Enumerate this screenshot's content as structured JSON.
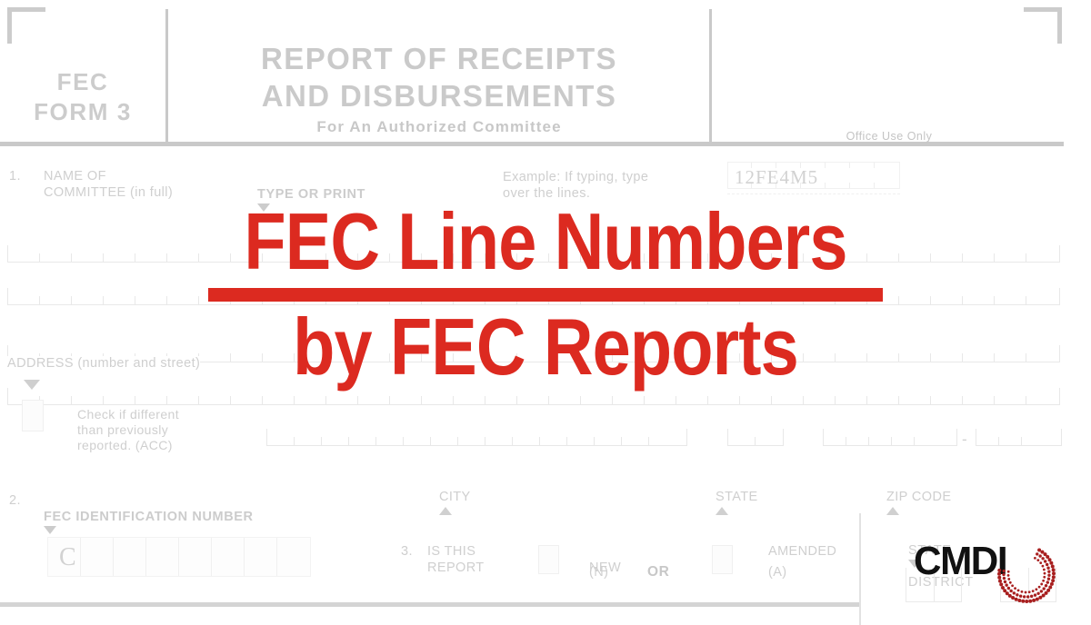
{
  "document": {
    "form_id_line1": "FEC",
    "form_id_line2": "FORM 3",
    "title_line1": "REPORT OF RECEIPTS",
    "title_line2": "AND DISBURSEMENTS",
    "subtitle": "For An Authorized Committee",
    "office_use_label": "Office Use Only",
    "office_use_code": "12FE4M5"
  },
  "section1": {
    "number": "1.",
    "label": "NAME OF\nCOMMITTEE (in full)",
    "type_or_print": "TYPE OR PRINT",
    "example_note": "Example: If typing, type\nover the lines.",
    "address_label": "ADDRESS (number and street)",
    "check_if_different": "Check if different\nthan previously\nreported. (ACC)",
    "city_label": "CITY",
    "state_label": "STATE",
    "zip_label": "ZIP CODE",
    "zip_separator": "-"
  },
  "section2": {
    "number": "2.",
    "label": "FEC IDENTIFICATION NUMBER",
    "prefix_char": "C"
  },
  "section3": {
    "number": "3.",
    "label": "IS THIS\nREPORT",
    "new_label": "NEW",
    "new_code": "(N)",
    "or_label": "OR",
    "amended_label": "AMENDED",
    "amended_code": "(A)"
  },
  "state_district": {
    "state_label": "STATE",
    "district_label": "DISTRICT"
  },
  "overlay": {
    "headline_line1": "FEC Line Numbers",
    "headline_line2": "by FEC Reports",
    "brand": "CMDI"
  },
  "colors": {
    "accent_red": "#DC2A20",
    "form_gray": "#cccccc",
    "rule_gray": "#c9c9c9",
    "logo_black": "#111111",
    "logo_red": "#A81F1F"
  }
}
